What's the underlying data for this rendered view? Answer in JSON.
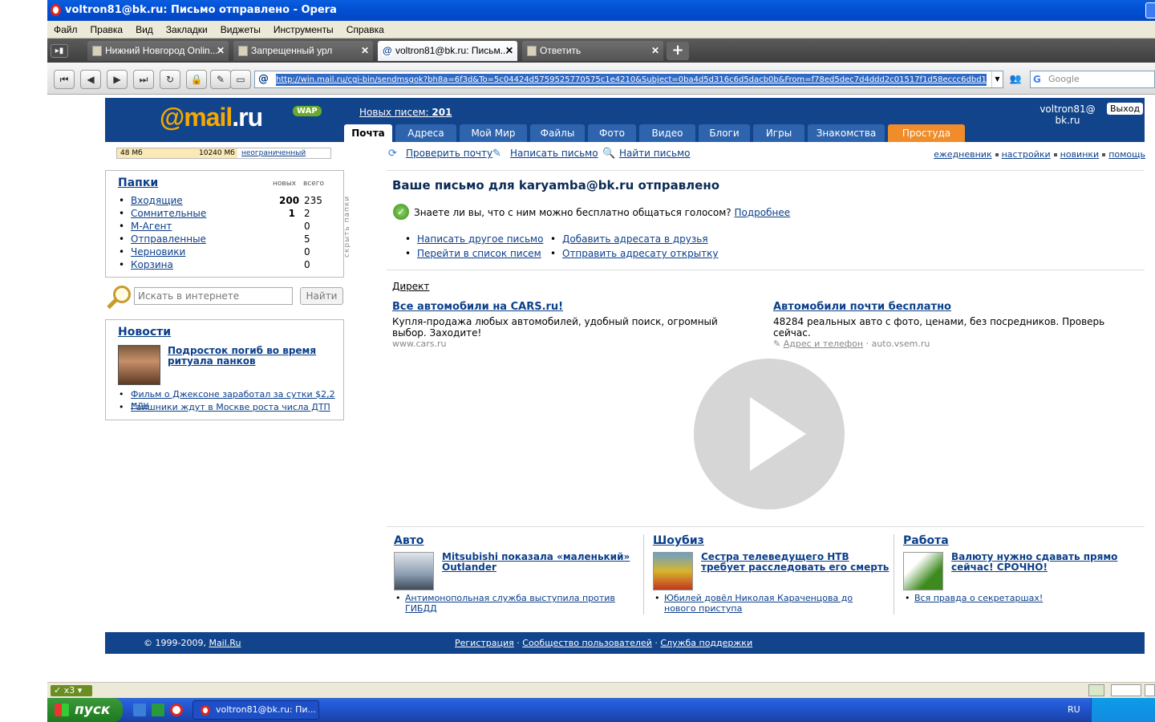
{
  "window": {
    "title": "voltron81@bk.ru: Письмо отправлено - Opera"
  },
  "menu": [
    "Файл",
    "Правка",
    "Вид",
    "Закладки",
    "Виджеты",
    "Инструменты",
    "Справка"
  ],
  "tabs": [
    {
      "label": "Нижний Новгород Onlin..."
    },
    {
      "label": "Запрещенный урл"
    },
    {
      "label": "voltron81@bk.ru: Письм..."
    },
    {
      "label": "Ответить"
    }
  ],
  "address": {
    "value": "http://win.mail.ru/cgi-bin/sendmsgok?bh8a=6f3d&To=5c04424d5759525770575c1e4210&Subject=0ba4d5d316c6d5dacb0b&From=f78ed5dec7d4ddd2c01517f1d58eccc6dbd1d915&use"
  },
  "search": {
    "placeholder": "Google"
  },
  "mail": {
    "logo_main": "@mail",
    "logo_ru": ".ru",
    "wap": "WAP",
    "new_mail_label": "Новых писем:",
    "new_mail_count": "201",
    "user_line1": "voltron81@",
    "user_line2": "bk.ru",
    "logout": "Выход",
    "tabs": [
      "Почта",
      "Адреса",
      "Мой Мир",
      "Файлы",
      "Фото",
      "Видео",
      "Блоги",
      "Игры",
      "Знакомства",
      "Простуда"
    ],
    "quota": {
      "used": "48 Мб",
      "total": "10240 Мб",
      "upgrade": "неограниченный",
      "used_fraction": 0.0047
    },
    "actions": {
      "check": "Проверить почту",
      "write": "Написать письмо",
      "find": "Найти письмо"
    },
    "right_links": [
      "ежедневник",
      "настройки",
      "новинки",
      "помощь"
    ]
  },
  "folders": {
    "title": "Папки",
    "col_new": "новых",
    "col_total": "всего",
    "hide": "скрыть папки",
    "items": [
      {
        "name": "Входящие",
        "new": "200",
        "total": "235"
      },
      {
        "name": "Сомнительные",
        "new": "1",
        "total": "2"
      },
      {
        "name": "М-Агент",
        "new": "",
        "total": "0"
      },
      {
        "name": "Отправленные",
        "new": "",
        "total": "5"
      },
      {
        "name": "Черновики",
        "new": "",
        "total": "0"
      },
      {
        "name": "Корзина",
        "new": "",
        "total": "0"
      }
    ]
  },
  "websearch": {
    "placeholder": "Искать в интернете",
    "button": "Найти"
  },
  "news": {
    "title": "Новости",
    "headline": "Подросток погиб во время ритуала панков",
    "items": [
      "Фильм о Джексоне заработал за сутки $2,2 млн",
      "Гаишники ждут в Москве роста числа ДТП"
    ]
  },
  "content": {
    "sent_message": "Ваше письмо для karyamba@bk.ru отправлено",
    "voice_text": "Знаете ли вы, что с ним можно бесплатно общаться голосом?",
    "voice_link": "Подробнее",
    "links": [
      "Написать другое письмо",
      "Перейти в список писем",
      "Добавить адресата в друзья",
      "Отправить адресату открытку"
    ],
    "direct": "Директ",
    "ads": [
      {
        "title": "Все автомобили на CARS.ru!",
        "desc": "Купля-продажа любых автомобилей, удобный поиск, огромный выбор. Заходите!",
        "url": "www.cars.ru"
      },
      {
        "title": "Автомобили почти бесплатно",
        "desc": "48284 реальных авто с фото, ценами, без посредников. Проверь сейчас.",
        "contact": "Адрес и телефон",
        "url": "auto.vsem.ru"
      }
    ]
  },
  "sections": [
    {
      "title": "Авто",
      "headline": "Mitsubishi показала «маленький» Outlander",
      "item": "Антимонопольная служба выступила против ГИБДД",
      "color": "#8a9bb0"
    },
    {
      "title": "Шоубиз",
      "headline": "Сестра телеведущего НТВ требует расследовать его смерть",
      "item": "Юбилей довёл Николая Караченцова до нового приступа",
      "color": "#d8b52c"
    },
    {
      "title": "Работа",
      "headline": "Валюту нужно сдавать прямо сейчас! СРОЧНО!",
      "item": "Вся правда о секретаршах!",
      "color": "#3d8a1e"
    }
  ],
  "footer": {
    "copyright": "© 1999-2009,",
    "brand": "Mail.Ru",
    "links": [
      "Регистрация",
      "Сообщество пользователей",
      "Служба поддержки"
    ]
  },
  "status": {
    "zoom": "x3"
  },
  "taskbar": {
    "start": "пуск",
    "task": "voltron81@bk.ru: Пи...",
    "lang": "RU"
  }
}
